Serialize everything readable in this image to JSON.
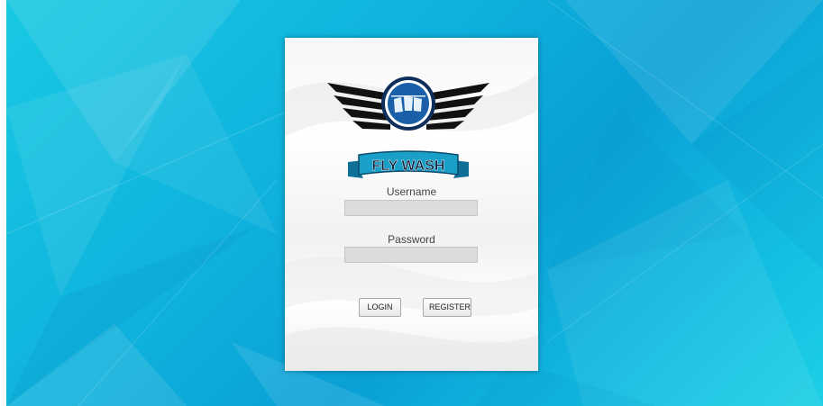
{
  "brand": {
    "logo_text": "FLY WASH",
    "colors": {
      "background_cyan": "#13bde0",
      "logo_blue": "#1a5fa8",
      "banner_teal": "#1aa0c8",
      "wing_black": "#111111"
    }
  },
  "login": {
    "username_label": "Username",
    "username_value": "",
    "password_label": "Password",
    "password_value": "",
    "login_label": "LOGIN",
    "register_label": "REGISTER"
  }
}
